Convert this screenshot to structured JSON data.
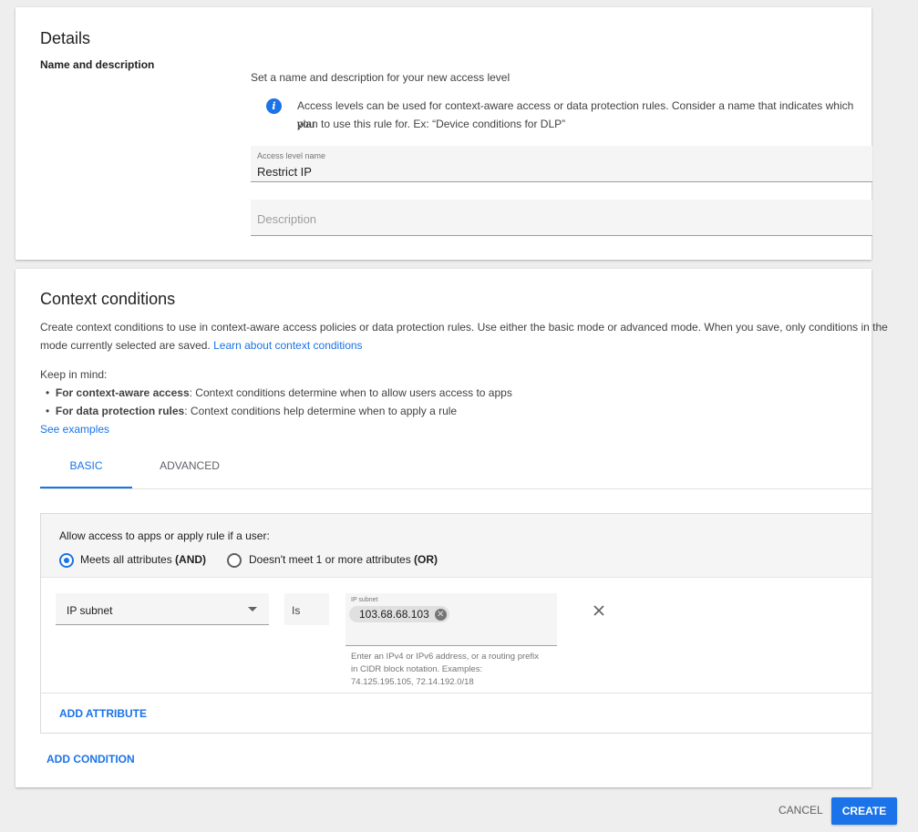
{
  "details": {
    "title": "Details",
    "section_label": "Name and description",
    "intro": "Set a name and description for your new access level",
    "info_line1": "Access levels can be used for context-aware access or data protection rules. Consider a name that indicates which you",
    "info_line2": "plan to use this rule for. Ex: “Device conditions for DLP”",
    "name_field": {
      "label": "Access level name",
      "value": "Restrict IP"
    },
    "description_field": {
      "placeholder": "Description"
    }
  },
  "context": {
    "title": "Context conditions",
    "desc_line1": "Create context conditions to use in context-aware access policies or data protection rules. Use either the basic mode or advanced mode. When you save, only conditions in the",
    "desc_line2": "mode currently selected are saved.",
    "learn_link": "Learn about context conditions",
    "keep_in_mind": "Keep in mind:",
    "bullets": [
      {
        "bold": "For context-aware access",
        "text": ": Context conditions determine when to allow users access to apps"
      },
      {
        "bold": "For data protection rules",
        "text": ": Context conditions help determine when to apply a rule"
      }
    ],
    "see_examples": "See examples",
    "tabs": [
      {
        "label": "BASIC",
        "active": true
      },
      {
        "label": "ADVANCED",
        "active": false
      }
    ],
    "rule": {
      "prompt": "Allow access to apps or apply rule if a user:",
      "option_and": {
        "text": "Meets all attributes ",
        "bold": "(AND)",
        "selected": true
      },
      "option_or": {
        "text": "Doesn't meet 1 or more attributes ",
        "bold": "(OR)",
        "selected": false
      },
      "attribute": {
        "type": "IP subnet",
        "operator": "Is",
        "value_label": "IP subnet",
        "chip": "103.68.68.103",
        "helper": [
          "Enter an IPv4 or IPv6 address, or a routing prefix",
          "in CIDR block notation. Examples:",
          "74.125.195.105, 72.14.192.0/18"
        ]
      },
      "add_attribute": "ADD ATTRIBUTE"
    },
    "add_condition": "ADD CONDITION"
  },
  "footer": {
    "cancel": "CANCEL",
    "create": "CREATE"
  },
  "colors": {
    "accent": "#1a73e8",
    "background": "#eeeeee"
  },
  "icons": [
    "info-icon",
    "close-icon",
    "chevron-down-icon",
    "chip-remove-icon"
  ]
}
